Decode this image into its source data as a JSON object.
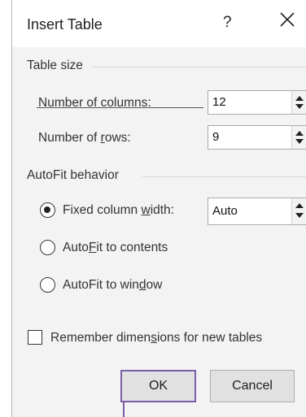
{
  "dialog": {
    "title": "Insert Table",
    "help_label": "?",
    "close_icon": "close-icon"
  },
  "table_size": {
    "group_label": "Table size",
    "columns": {
      "label_pre": "Number of ",
      "label_u": "c",
      "label_post": "olumns:",
      "value": "12"
    },
    "rows": {
      "label_pre": "Number of ",
      "label_u": "r",
      "label_post": "ows:",
      "value": "9"
    }
  },
  "autofit": {
    "group_label": "AutoFit behavior",
    "fixed": {
      "label_pre": "Fixed column ",
      "label_u": "w",
      "label_post": "idth:",
      "value": "Auto",
      "selected": true
    },
    "contents": {
      "label_pre": "Auto",
      "label_u": "F",
      "label_post": "it to contents",
      "selected": false
    },
    "window": {
      "label_pre": "AutoFit to win",
      "label_u": "d",
      "label_post": "ow",
      "selected": false
    }
  },
  "remember": {
    "label_pre": "Remember dimen",
    "label_u": "s",
    "label_post": "ions for new tables",
    "checked": false
  },
  "buttons": {
    "ok": "OK",
    "cancel": "Cancel"
  },
  "colors": {
    "focus": "#7b5ea7",
    "dialog_bg": "#f3f3f3"
  }
}
